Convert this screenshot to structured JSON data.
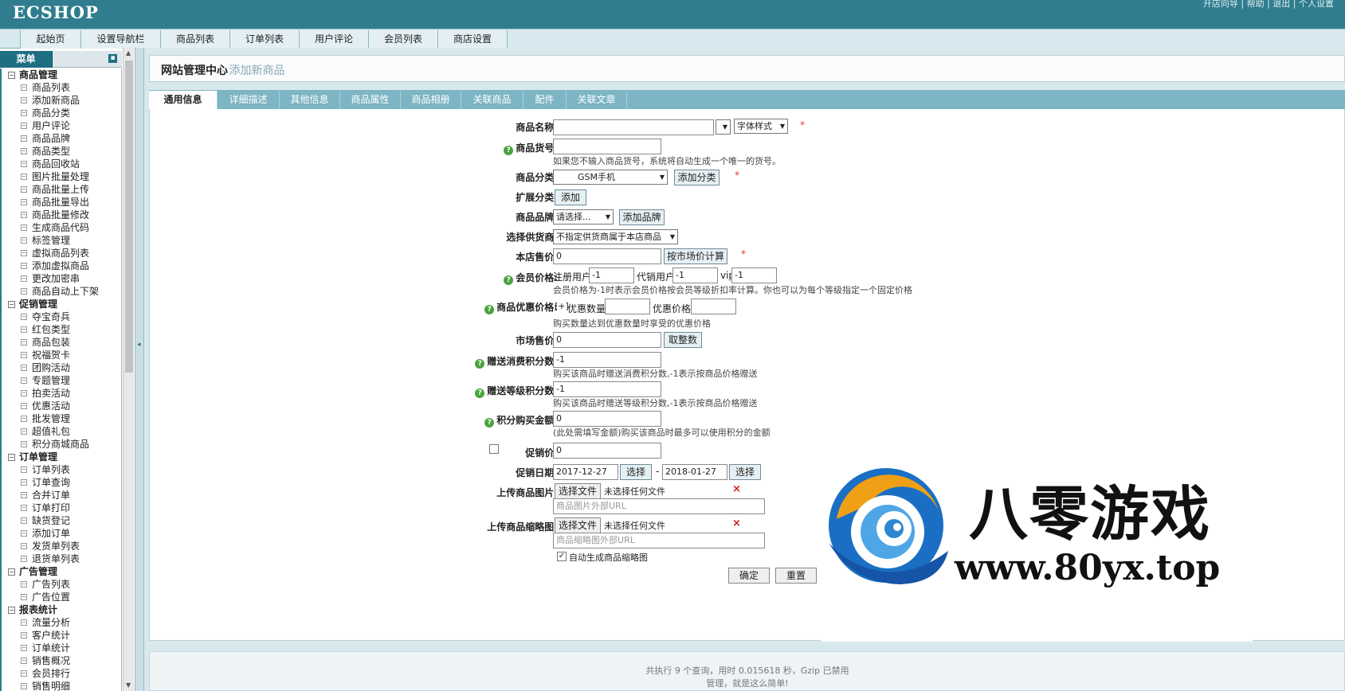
{
  "app": {
    "logo": "ECSHOP",
    "top_links": "开店向导 | 帮助 | 退出 | 个人设置"
  },
  "nav": [
    "起始页",
    "设置导航栏",
    "商品列表",
    "订单列表",
    "用户评论",
    "会员列表",
    "商店设置"
  ],
  "menu": {
    "title": "菜单",
    "toggle": "▪",
    "groups": [
      {
        "label": "商品管理",
        "items": [
          "商品列表",
          "添加新商品",
          "商品分类",
          "用户评论",
          "商品品牌",
          "商品类型",
          "商品回收站",
          "图片批量处理",
          "商品批量上传",
          "商品批量导出",
          "商品批量修改",
          "生成商品代码",
          "标签管理",
          "虚拟商品列表",
          "添加虚拟商品",
          "更改加密串",
          "商品自动上下架"
        ]
      },
      {
        "label": "促销管理",
        "items": [
          "夺宝奇兵",
          "红包类型",
          "商品包装",
          "祝福贺卡",
          "团购活动",
          "专题管理",
          "拍卖活动",
          "优惠活动",
          "批发管理",
          "超值礼包",
          "积分商城商品"
        ]
      },
      {
        "label": "订单管理",
        "items": [
          "订单列表",
          "订单查询",
          "合并订单",
          "订单打印",
          "缺货登记",
          "添加订单",
          "发货单列表",
          "退货单列表"
        ]
      },
      {
        "label": "广告管理",
        "items": [
          "广告列表",
          "广告位置"
        ]
      },
      {
        "label": "报表统计",
        "items": [
          "流量分析",
          "客户统计",
          "订单统计",
          "销售概况",
          "会员排行",
          "销售明细"
        ]
      }
    ]
  },
  "page": {
    "heading": "网站管理中心",
    "subheading": "- 添加新商品"
  },
  "tabs": [
    "通用信息",
    "详细描述",
    "其他信息",
    "商品属性",
    "商品相册",
    "关联商品",
    "配件",
    "关联文章"
  ],
  "form": {
    "goods_name_label": "商品名称:",
    "font_style": "字体样式",
    "goods_sn_label": "商品货号:",
    "goods_sn_hint": "如果您不输入商品货号，系统将自动生成一个唯一的货号。",
    "category_label": "商品分类:",
    "category_value": "GSM手机",
    "add_category_btn": "添加分类",
    "ext_category_label": "扩展分类:",
    "ext_add_btn": "添加",
    "brand_label": "商品品牌:",
    "brand_value": "请选择...",
    "add_brand_btn": "添加品牌",
    "supplier_label": "选择供货商:",
    "supplier_value": "不指定供货商属于本店商品",
    "shop_price_label": "本店售价:",
    "shop_price_value": "0",
    "market_calc_btn": "按市场价计算",
    "member_price_label": "会员价格:",
    "member_reg_label": "注册用户",
    "member_reg_value": "-1",
    "member_agent_label": "代销用户",
    "member_agent_value": "-1",
    "member_vip_label": "vip",
    "member_vip_value": "-1",
    "member_price_hint": "会员价格为-1时表示会员价格按会员等级折扣率计算。你也可以为每个等级指定一个固定价格",
    "volume_price_label": "商品优惠价格:",
    "volume_add": "[+]",
    "volume_qty_label": "优惠数量",
    "volume_price_field_label": "优惠价格",
    "volume_hint": "购买数量达到优惠数量时享受的优惠价格",
    "market_price_label": "市场售价:",
    "market_price_value": "0",
    "round_btn": "取整数",
    "give_integral_label": "赠送消费积分数:",
    "give_integral_value": "-1",
    "give_integral_hint": "购买该商品时赠送消费积分数,-1表示按商品价格赠送",
    "rank_integral_label": "赠送等级积分数:",
    "rank_integral_value": "-1",
    "rank_integral_hint": "购买该商品时赠送等级积分数,-1表示按商品价格赠送",
    "integral_label": "积分购买金额:",
    "integral_value": "0",
    "integral_hint": "(此处需填写金额)购买该商品时最多可以使用积分的金额",
    "promote_label": "促销价:",
    "promote_value": "0",
    "promote_date_label": "促销日期:",
    "promote_start": "2017-12-27",
    "promote_end": "2018-01-27",
    "choose_btn": "选择",
    "date_sep": "-",
    "upload_img_label": "上传商品图片:",
    "upload_thumb_label": "上传商品缩略图:",
    "file_btn": "选择文件",
    "no_file": "未选择任何文件",
    "img_url_placeholder": "商品图片外部URL",
    "thumb_url_placeholder": "商品缩略图外部URL",
    "auto_thumb_label": "自动生成商品缩略图",
    "required_mark": "*",
    "remove_mark": "×",
    "info_mark": "?",
    "submit_btn": "确定",
    "reset_btn": "重置"
  },
  "footer": {
    "line1": "共执行 9 个查询，用时 0.015618 秒，Gzip 已禁用",
    "line2": "管理，就是这么简单!"
  },
  "watermark": {
    "text": "八零游戏",
    "url": "www.80yx.top"
  },
  "colors": {
    "header": "#2f7d8f",
    "tab_bar": "#7db5c4",
    "required": "#e33333",
    "info_icon": "#4aa33d"
  }
}
